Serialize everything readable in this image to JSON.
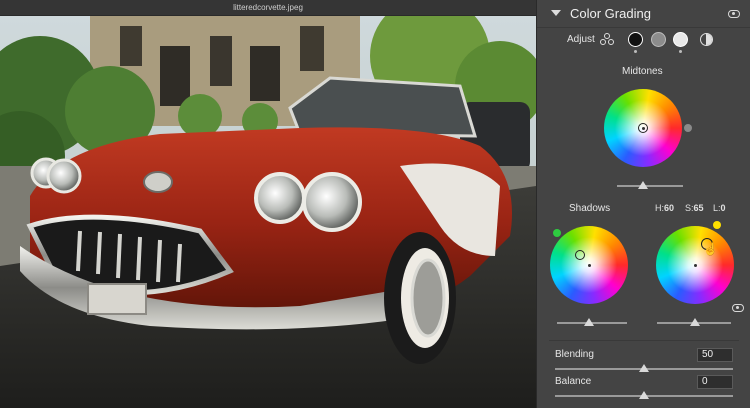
{
  "document": {
    "filename": "litteredcorvette.jpeg"
  },
  "panel": {
    "title": "Color Grading",
    "adjust_label": "Adjust",
    "adjust_modes": [
      "three-way-icon",
      "shadows-mode",
      "midtones-mode",
      "highlights-mode",
      "global-mode"
    ],
    "midtones": {
      "label": "Midtones",
      "color": "#f2f2f2"
    },
    "shadows": {
      "label": "Shadows",
      "indicator_color": "#2ecc40"
    },
    "highlights": {
      "indicator_color": "#ffe000"
    },
    "hsl": {
      "h_label": "H:",
      "h_value": "60",
      "s_label": "S:",
      "s_value": "65",
      "l_label": "L:",
      "l_value": "0"
    },
    "blending": {
      "label": "Blending",
      "value": "50"
    },
    "balance": {
      "label": "Balance",
      "value": "0"
    }
  }
}
